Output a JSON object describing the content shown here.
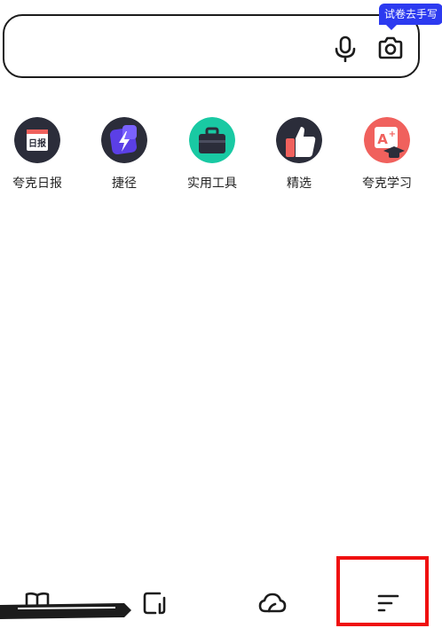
{
  "search": {
    "value": "",
    "placeholder": "",
    "badge_text": "试卷去手写",
    "mic_icon": "microphone-icon",
    "camera_icon": "camera-icon"
  },
  "shortcuts": [
    {
      "label": "夸克日报",
      "icon": "daily-news-icon",
      "glyph": "日报",
      "color": "#2b2d3a"
    },
    {
      "label": "捷径",
      "icon": "lightning-shortcut-icon",
      "color": "#5b3fe6"
    },
    {
      "label": "实用工具",
      "icon": "toolbox-icon",
      "color": "#19c9a3"
    },
    {
      "label": "精选",
      "icon": "thumbs-up-icon",
      "color": "#2b2d3a"
    },
    {
      "label": "夸克学习",
      "icon": "study-aplus-icon",
      "glyph": "A+",
      "color": "#f0615d"
    }
  ],
  "bottom_nav": [
    {
      "name": "nav-books",
      "icon": "book-icon"
    },
    {
      "name": "nav-tabs",
      "icon": "tabs-icon"
    },
    {
      "name": "nav-cloud",
      "icon": "cloud-icon"
    },
    {
      "name": "nav-menu",
      "icon": "menu-icon"
    }
  ],
  "colors": {
    "accent": "#2c3af0",
    "highlight": "#ef1010",
    "text": "#222222",
    "border": "#1c1c1c"
  }
}
